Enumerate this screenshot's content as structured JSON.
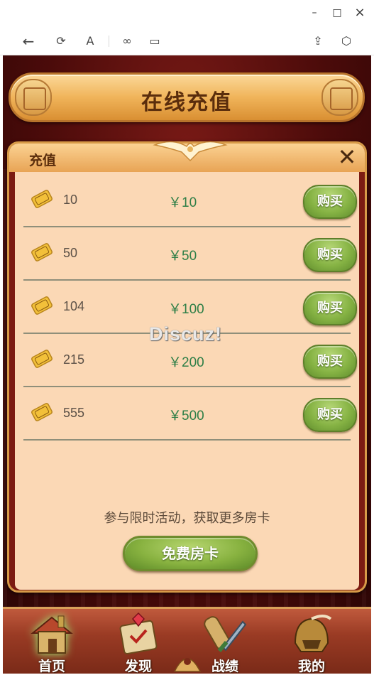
{
  "window": {
    "minimize": "–",
    "maximize": "□",
    "close": "×"
  },
  "toolbar": {
    "back": "←",
    "refresh": "⟳",
    "reader": "A",
    "link": "∞",
    "tab": "▭",
    "share": "⇪",
    "box": "⬡"
  },
  "banner": {
    "title": "在线充值"
  },
  "panel": {
    "title": "充值",
    "close": "✕",
    "rows": [
      {
        "amount": "10",
        "price": "￥10",
        "button": "购买"
      },
      {
        "amount": "50",
        "price": "￥50",
        "button": "购买"
      },
      {
        "amount": "104",
        "price": "￥100",
        "button": "购买"
      },
      {
        "amount": "215",
        "price": "￥200",
        "button": "购买"
      },
      {
        "amount": "555",
        "price": "￥500",
        "button": "购买"
      }
    ],
    "card_label": "房卡",
    "promo_text": "参与限时活动，获取更多房卡",
    "free_button": "免费房卡"
  },
  "watermark": "Discuz!",
  "nav": [
    {
      "label": "首页",
      "icon": "home-house-icon",
      "active": true
    },
    {
      "label": "发现",
      "icon": "discover-scroll-icon",
      "active": false
    },
    {
      "label": "战绩",
      "icon": "record-sword-icon",
      "active": false
    },
    {
      "label": "我的",
      "icon": "profile-helmet-icon",
      "active": false
    }
  ],
  "colors": {
    "accent_gold": "#d79a48",
    "price_green": "#2f7f47",
    "button_green": "#86b344",
    "panel_bg": "#fbd8b5"
  }
}
